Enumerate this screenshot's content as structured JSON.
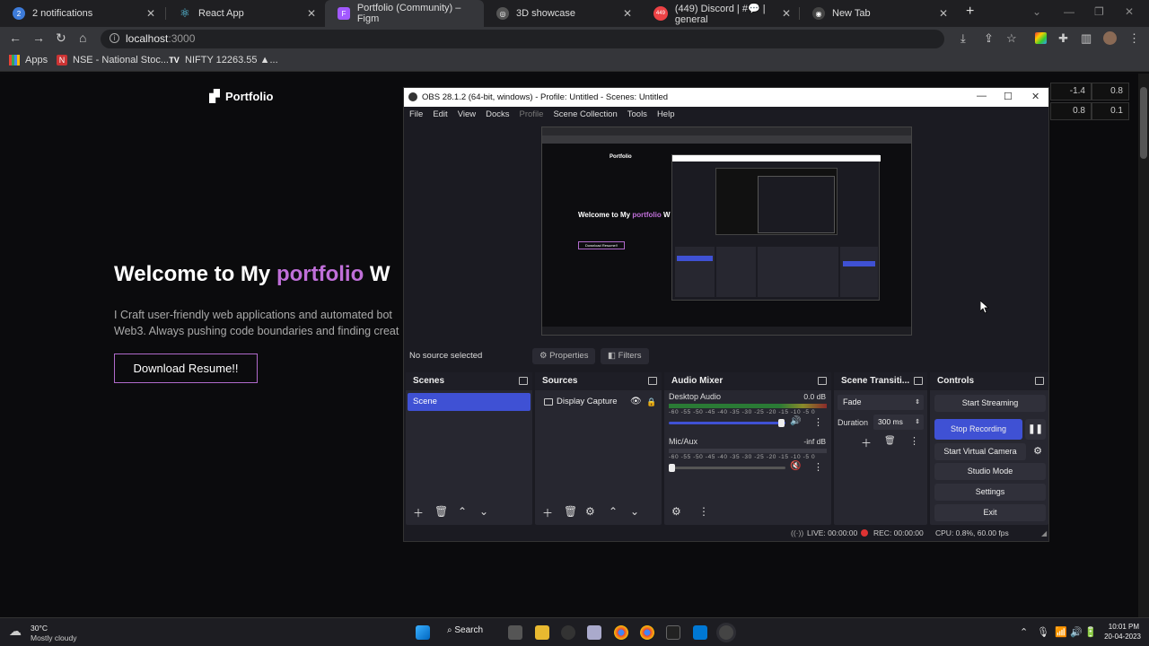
{
  "browser": {
    "tabs": [
      {
        "label": "2 notifications",
        "icon_text": "2",
        "color": "#3d7bd9"
      },
      {
        "label": "React App",
        "icon_text": "⚛",
        "color": "#1e1e22"
      },
      {
        "label": "Portfolio (Community) – Figm",
        "icon_text": "F",
        "color": "#a259ff"
      },
      {
        "label": "3D showcase",
        "icon_text": "◎",
        "color": "#555"
      },
      {
        "label": "(449) Discord | #💬 | general",
        "icon_text": "449",
        "color": "#ed4245"
      },
      {
        "label": "New Tab",
        "icon_text": "◉",
        "color": "#444"
      }
    ],
    "url": "localhost",
    "url_port": ":3000",
    "bookmarks": [
      {
        "label": "Apps"
      },
      {
        "label": "NSE - National Stoc..."
      },
      {
        "label": "NIFTY 12263.55 ▲..."
      }
    ]
  },
  "page": {
    "logo": "Portfolio",
    "hero_prefix": "Welcome to My ",
    "hero_accent": "portfolio",
    "hero_suffix": " W",
    "subtitle_line1": "I Craft user-friendly web applications and automated bot",
    "subtitle_line2": "Web3. Always pushing code boundaries and finding creat",
    "download_button": "Download Resume!!",
    "side_values": [
      "-1.4",
      "0.8",
      "0.8",
      "0.1"
    ]
  },
  "obs": {
    "title": "OBS 28.1.2 (64-bit, windows) - Profile: Untitled - Scenes: Untitled",
    "menu": [
      "File",
      "Edit",
      "View",
      "Docks",
      "Profile",
      "Scene Collection",
      "Tools",
      "Help"
    ],
    "no_source": "No source selected",
    "properties": "Properties",
    "filters": "Filters",
    "scenes_title": "Scenes",
    "scene_item": "Scene",
    "sources_title": "Sources",
    "source_item": "Display Capture",
    "mixer_title": "Audio Mixer",
    "desktop_audio": "Desktop Audio",
    "desktop_db": "0.0 dB",
    "mic_aux": "Mic/Aux",
    "mic_db": "-inf dB",
    "ticks": "-60 -55 -50 -45 -40 -35 -30 -25 -20 -15 -10 -5 0",
    "transitions_title": "Scene Transiti...",
    "transition_value": "Fade",
    "duration_label": "Duration",
    "duration_value": "300 ms",
    "controls_title": "Controls",
    "start_streaming": "Start Streaming",
    "stop_recording": "Stop Recording",
    "start_virtual_camera": "Start Virtual Camera",
    "studio_mode": "Studio Mode",
    "settings": "Settings",
    "exit": "Exit",
    "live": "LIVE: 00:00:00",
    "rec": "REC: 00:00:00",
    "cpu": "CPU: 0.8%, 60.00 fps",
    "preview_title": "Welcome to My ",
    "preview_accent": "portfolio",
    "preview_suffix": " W",
    "preview_logo": "Portfolio",
    "preview_button": "Download Resume!!",
    "accent_color": "#3f51d4"
  },
  "taskbar": {
    "weather_temp": "30°C",
    "weather_desc": "Mostly cloudy",
    "search": "Search",
    "time": "10:01 PM",
    "date": "20-04-2023"
  }
}
